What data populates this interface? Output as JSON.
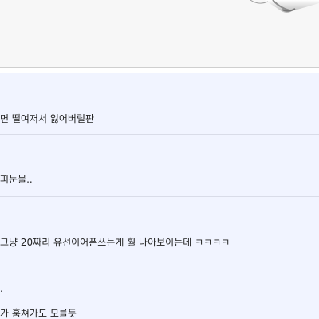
{
  "comments": [
    {
      "text": "면 떨여저서 잃어버릴판"
    },
    {
      "text": "피눈물.."
    },
    {
      "text": "그냥 20짜리 유선이어폰쓰는게 훨 나아보이는데 ㅋㅋㅋㅋ"
    },
    {
      "line1": ".",
      "line2": "가 훔쳐가도 모를듯"
    }
  ],
  "colors": {
    "comment_bg": "#f1f4ff",
    "top_panel_bg": "#f7f7f7"
  },
  "icons": {
    "product": "earphone-image"
  }
}
